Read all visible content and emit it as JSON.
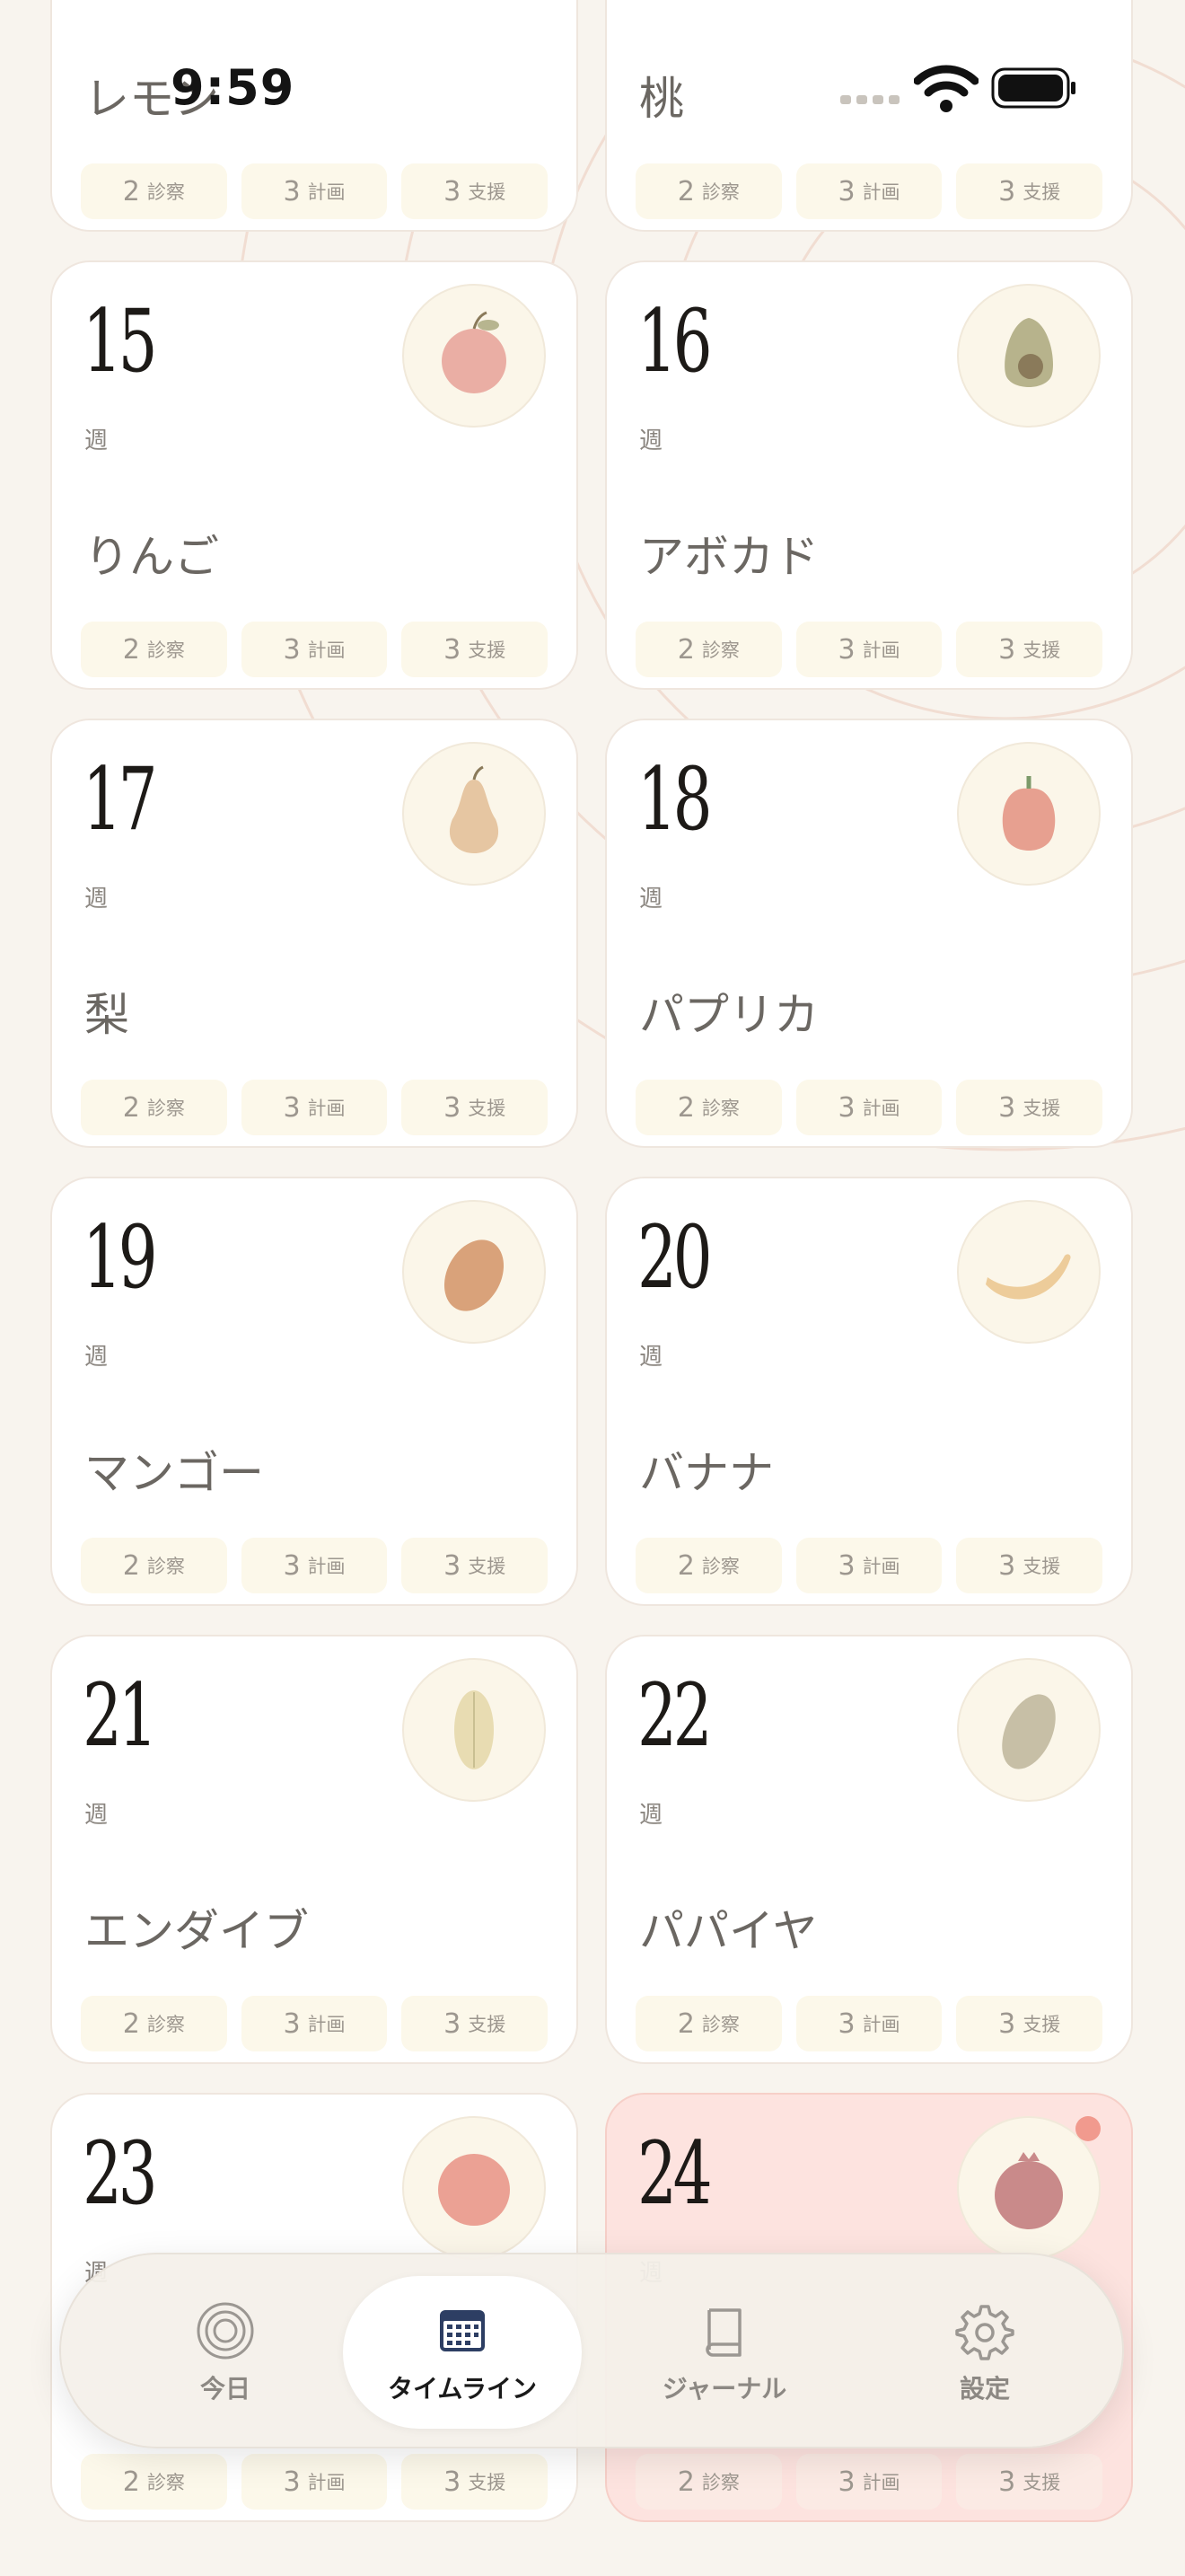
{
  "status_bar": {
    "time": "9:59"
  },
  "unit_label": "週",
  "chip_labels": {
    "visits": "診察",
    "plans": "計画",
    "support": "支援"
  },
  "top_cards": [
    {
      "name": "レモン",
      "visits": "2",
      "plans": "3",
      "support": "3"
    },
    {
      "name": "桃",
      "visits": "2",
      "plans": "3",
      "support": "3"
    }
  ],
  "weeks": [
    {
      "week": "15",
      "name": "りんご",
      "fruit_icon": "apple-icon",
      "fruit_color": "#e8a69c",
      "visits": "2",
      "plans": "3",
      "support": "3"
    },
    {
      "week": "16",
      "name": "アボカド",
      "fruit_icon": "avocado-icon",
      "fruit_color": "#b7b38c",
      "visits": "2",
      "plans": "3",
      "support": "3"
    },
    {
      "week": "17",
      "name": "梨",
      "fruit_icon": "pear-icon",
      "fruit_color": "#e6c6a2",
      "visits": "2",
      "plans": "3",
      "support": "3"
    },
    {
      "week": "18",
      "name": "パプリカ",
      "fruit_icon": "bell-pepper-icon",
      "fruit_color": "#e7a090",
      "visits": "2",
      "plans": "3",
      "support": "3"
    },
    {
      "week": "19",
      "name": "マンゴー",
      "fruit_icon": "mango-icon",
      "fruit_color": "#d9a27a",
      "visits": "2",
      "plans": "3",
      "support": "3"
    },
    {
      "week": "20",
      "name": "バナナ",
      "fruit_icon": "banana-icon",
      "fruit_color": "#edcc9a",
      "visits": "2",
      "plans": "3",
      "support": "3"
    },
    {
      "week": "21",
      "name": "エンダイブ",
      "fruit_icon": "endive-icon",
      "fruit_color": "#e8dcb2",
      "visits": "2",
      "plans": "3",
      "support": "3"
    },
    {
      "week": "22",
      "name": "パパイヤ",
      "fruit_icon": "papaya-icon",
      "fruit_color": "#c7bfa6",
      "visits": "2",
      "plans": "3",
      "support": "3"
    },
    {
      "week": "23",
      "name": "",
      "fruit_icon": "grapefruit-icon",
      "fruit_color": "#eba194",
      "visits": "2",
      "plans": "3",
      "support": "3"
    },
    {
      "week": "24",
      "name": "",
      "fruit_icon": "pomegranate-icon",
      "fruit_color": "#c98a8a",
      "visits": "2",
      "plans": "3",
      "support": "3",
      "current": true
    }
  ],
  "tabbar": {
    "tabs": [
      {
        "id": "today",
        "label": "今日",
        "icon": "target-icon"
      },
      {
        "id": "timeline",
        "label": "タイムライン",
        "icon": "calendar-icon",
        "active": true
      },
      {
        "id": "journal",
        "label": "ジャーナル",
        "icon": "book-icon"
      },
      {
        "id": "settings",
        "label": "設定",
        "icon": "gear-icon"
      }
    ]
  },
  "colors": {
    "background": "#f8f4ee",
    "card": "#ffffff",
    "current_card": "#fde3df",
    "chip": "#fcf8ea",
    "notification": "#f19a8e"
  }
}
